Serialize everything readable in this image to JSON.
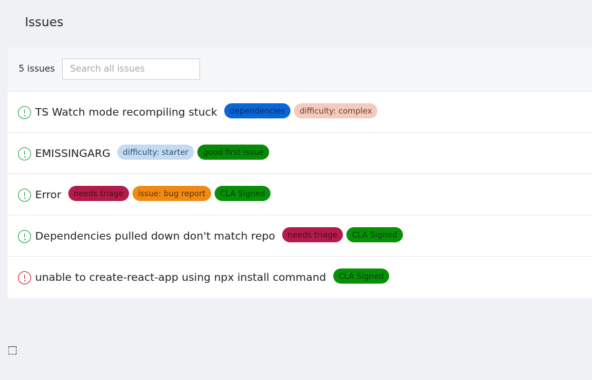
{
  "page": {
    "title": "Issues"
  },
  "toolbar": {
    "count_text": "5 issues",
    "search_placeholder": "Search all issues",
    "search_value": ""
  },
  "issues": [
    {
      "title": "TS Watch mode recompiling stuck",
      "state": "open",
      "labels": [
        {
          "text": "dependencies",
          "bg": "#0a66d6",
          "fg": "#0b2a55"
        },
        {
          "text": "difficulty: complex",
          "bg": "#f6cbbf",
          "fg": "#6a3a2c"
        }
      ]
    },
    {
      "title": "EMISSINGARG",
      "state": "open",
      "labels": [
        {
          "text": "difficulty: starter",
          "bg": "#c2dbf3",
          "fg": "#3a4e66"
        },
        {
          "text": "good first issue",
          "bg": "#058a05",
          "fg": "#073b07"
        }
      ]
    },
    {
      "title": "Error",
      "state": "open",
      "labels": [
        {
          "text": "needs triage",
          "bg": "#b31c4a",
          "fg": "#4a0b1e"
        },
        {
          "text": "issue: bug report",
          "bg": "#f08a14",
          "fg": "#5a3305"
        },
        {
          "text": "CLA Signed",
          "bg": "#079107",
          "fg": "#0b3d0b"
        }
      ]
    },
    {
      "title": "Dependencies pulled down don't match repo",
      "state": "open",
      "labels": [
        {
          "text": "needs triage",
          "bg": "#b31c4a",
          "fg": "#4a0b1e"
        },
        {
          "text": "CLA Signed",
          "bg": "#079107",
          "fg": "#0b3d0b"
        }
      ]
    },
    {
      "title": "unable to create-react-app using npx install command",
      "state": "closed",
      "labels": [
        {
          "text": "CLA Signed",
          "bg": "#079107",
          "fg": "#0b3d0b"
        }
      ]
    }
  ]
}
